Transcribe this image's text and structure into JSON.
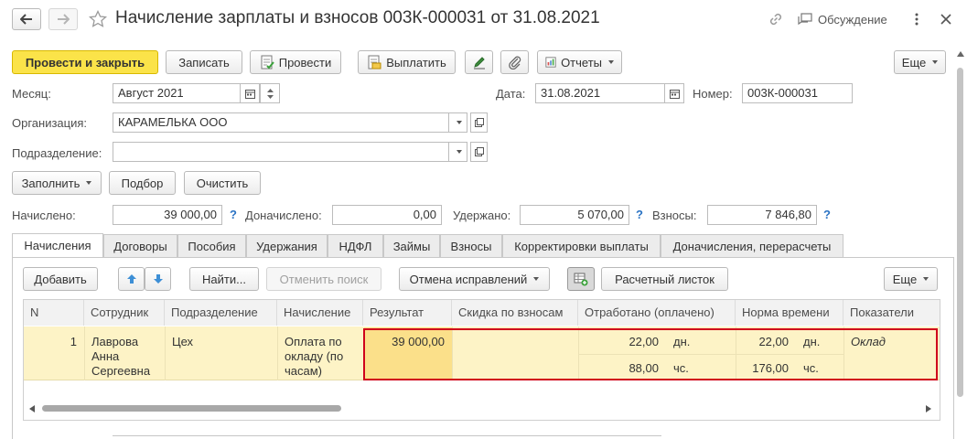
{
  "window": {
    "title": "Начисление зарплаты и взносов 003К-000031 от 31.08.2021",
    "discussion": "Обсуждение"
  },
  "toolbar": {
    "post_close": "Провести и закрыть",
    "save": "Записать",
    "post": "Провести",
    "pay": "Выплатить",
    "reports": "Отчеты",
    "more": "Еще"
  },
  "header": {
    "month_label": "Месяц:",
    "month_value": "Август 2021",
    "date_label": "Дата:",
    "date_value": "31.08.2021",
    "number_label": "Номер:",
    "number_value": "003К-000031",
    "org_label": "Организация:",
    "org_value": "КАРАМЕЛЬКА ООО",
    "dept_label": "Подразделение:",
    "dept_value": ""
  },
  "actions": {
    "fill": "Заполнить",
    "select": "Подбор",
    "clear": "Очистить"
  },
  "totals": {
    "accrued_label": "Начислено:",
    "accrued_value": "39 000,00",
    "extra_label": "Доначислено:",
    "extra_value": "0,00",
    "withheld_label": "Удержано:",
    "withheld_value": "5 070,00",
    "contrib_label": "Взносы:",
    "contrib_value": "7 846,80",
    "help": "?"
  },
  "tabs": [
    "Начисления",
    "Договоры",
    "Пособия",
    "Удержания",
    "НДФЛ",
    "Займы",
    "Взносы",
    "Корректировки выплаты",
    "Доначисления, перерасчеты"
  ],
  "table_toolbar": {
    "add": "Добавить",
    "find": "Найти...",
    "cancel_search": "Отменить поиск",
    "cancel_fixes": "Отмена исправлений",
    "payslip": "Расчетный листок",
    "more": "Еще"
  },
  "table": {
    "columns": [
      "N",
      "Сотрудник",
      "Подразделение",
      "Начисление",
      "Результат",
      "Скидка по взносам",
      "Отработано (оплачено)",
      "Норма времени",
      "Показатели"
    ],
    "row": {
      "n": "1",
      "employee": "Лаврова Анна Сергеевна",
      "department": "Цех",
      "accrual": "Оплата по окладу (по часам)",
      "result": "39 000,00",
      "worked_days": "22,00",
      "worked_days_unit": "дн.",
      "worked_hours": "88,00",
      "worked_hours_unit": "чс.",
      "norm_days": "22,00",
      "norm_days_unit": "дн.",
      "norm_hours": "176,00",
      "norm_hours_unit": "чс.",
      "indicator": "Оклад"
    }
  },
  "colors": {
    "primary_button": "#fbe349",
    "row_highlight": "#fdf3c6",
    "selected_cell": "#fbe08a",
    "highlight_border": "#d0021b",
    "help_blue": "#2a73c4",
    "sort_arrow_blue": "#3d8fd6"
  }
}
